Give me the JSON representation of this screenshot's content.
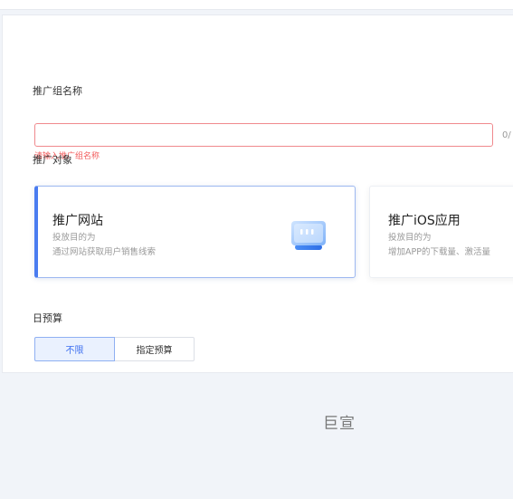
{
  "form": {
    "group_name_label": "推广组名称",
    "group_name_value": "",
    "group_name_placeholder": "",
    "group_name_counter": "0/",
    "group_name_error": "请输入推广组名称",
    "target_label": "推广对象",
    "targets": [
      {
        "title": "推广网站",
        "line1": "投放目的为",
        "line2": "通过网站获取用户销售线索",
        "selected": true,
        "icon": "monitor-icon"
      },
      {
        "title": "推广iOS应用",
        "line1": "投放目的为",
        "line2": "增加APP的下载量、激活量",
        "selected": false
      }
    ],
    "budget_label": "日预算",
    "budget_options": [
      "不限",
      "指定预算"
    ],
    "budget_selected": "不限"
  },
  "footer": {
    "text": "巨宣"
  },
  "colors": {
    "accent": "#4a7cf0",
    "error": "#f25c5c",
    "page_bg": "#f1f4f9"
  }
}
